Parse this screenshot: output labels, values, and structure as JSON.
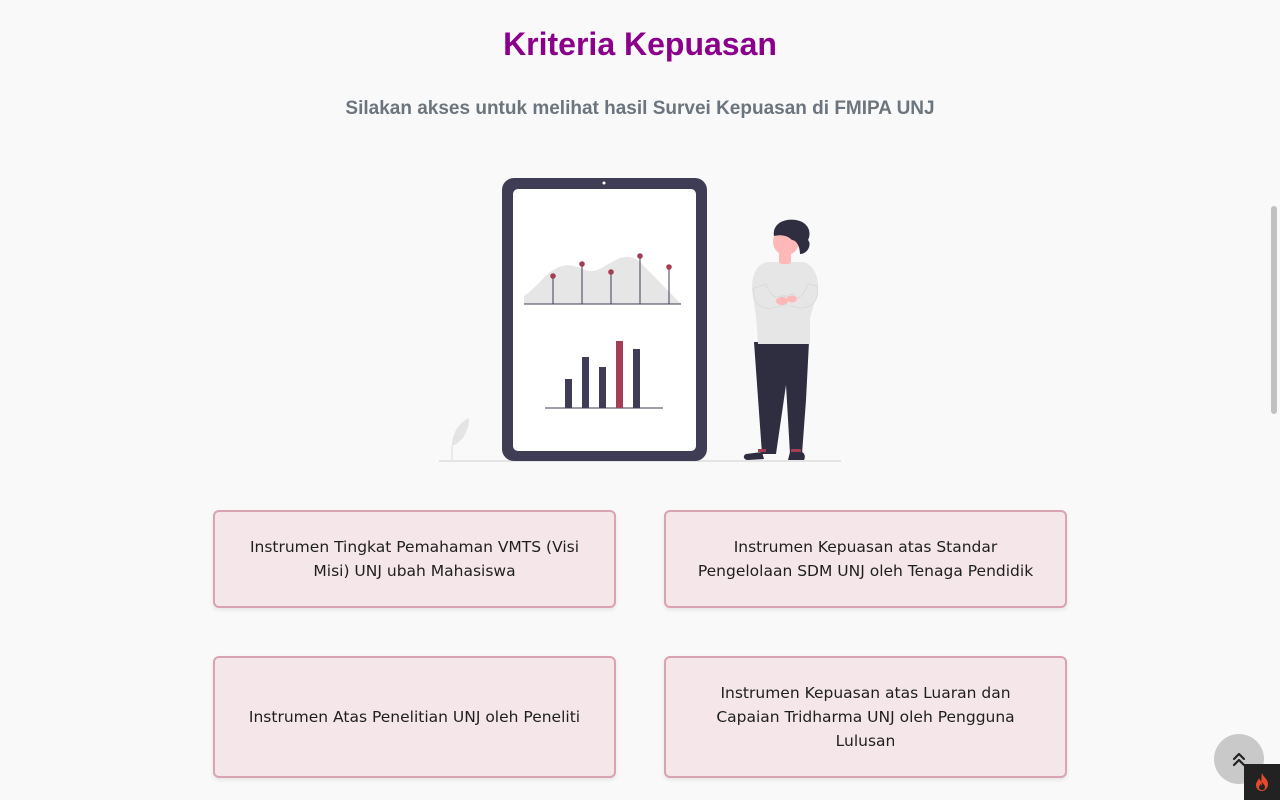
{
  "header": {
    "title": "Kriteria Kepuasan",
    "subtitle": "Silakan akses untuk melihat hasil Survei Kepuasan di FMIPA UNJ"
  },
  "cards": [
    {
      "label": "Instrumen Tingkat Pemahaman VMTS (Visi Misi) UNJ ubah Mahasiswa"
    },
    {
      "label": "Instrumen Kepuasan atas Standar Pengelolaan SDM UNJ oleh Tenaga Pendidik"
    },
    {
      "label": "Instrumen Atas Penelitian UNJ oleh Peneliti"
    },
    {
      "label": "Instrumen Kepuasan atas Luaran dan Capaian Tridharma UNJ oleh Pengguna Lulusan"
    }
  ],
  "icons": {
    "back_to_top": "double-chevron-up-icon",
    "debug_toolbar": "flame-icon"
  },
  "colors": {
    "title": "#8b008b",
    "subtitle": "#6c757d",
    "card_bg": "#f4e6e9",
    "card_border": "#d9a3b1",
    "accent_red": "#a53e55",
    "device_frame": "#3f3d56"
  }
}
